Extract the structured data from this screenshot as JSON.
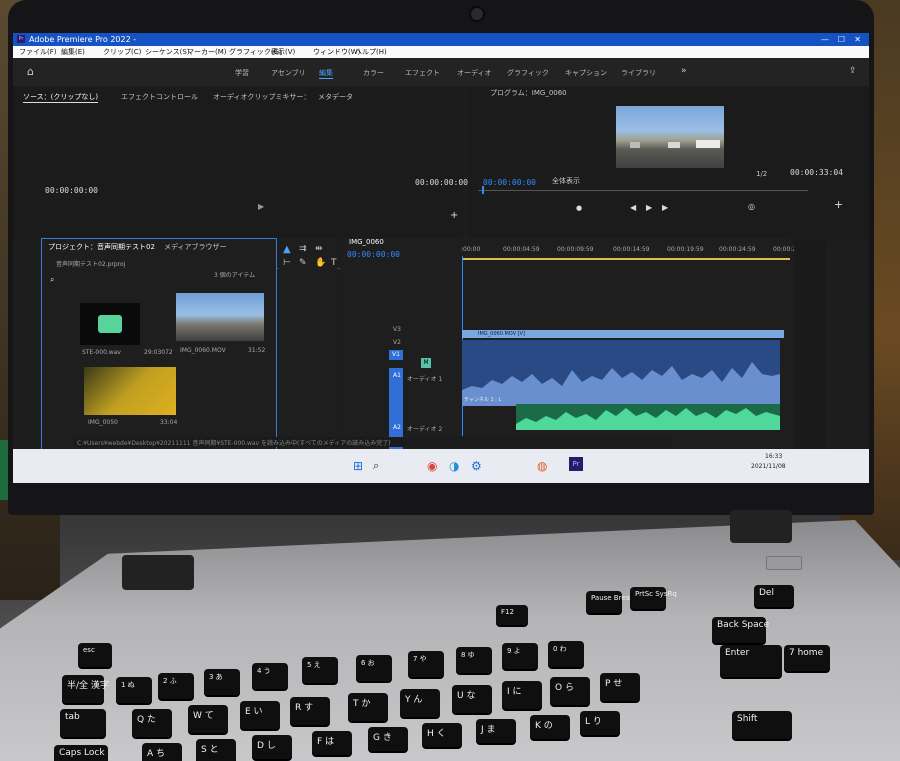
{
  "app": {
    "title": "Adobe Premiere Pro 2022 -",
    "menu": [
      "ファイル(F)",
      "編集(E)",
      "クリップ(C)",
      "シーケンス(S)",
      "マーカー(M)",
      "グラフィック(G)",
      "表示(V)",
      "ウィンドウ(W)",
      "ヘルプ(H)"
    ],
    "workspaces": [
      "学習",
      "アセンブリ",
      "編集",
      "カラー",
      "エフェクト",
      "オーディオ",
      "グラフィック",
      "キャプション",
      "ライブラリ"
    ],
    "active_workspace": "編集",
    "more": "»"
  },
  "source": {
    "tabs": [
      "ソース：(クリップなし)",
      "エフェクトコントロール",
      "オーディオクリップミキサー：",
      "メタデータ"
    ],
    "timecode": "00:00:00:00"
  },
  "program": {
    "title": "プログラム：IMG_0060",
    "timecode_in": "00:00:00:00",
    "timecode_cur": "00:00:00:00",
    "fit": "全体表示",
    "resolution": "1/2",
    "duration": "00:00:33:04"
  },
  "project": {
    "title": "プロジェクト：音声同期テスト02",
    "tab2": "メディアブラウザー",
    "file": "音声同期テスト02.prproj",
    "count": "3 個のアイテム",
    "items": [
      {
        "name": "STE-000.wav",
        "duration": "29:03072"
      },
      {
        "name": "IMG_0060.MOV",
        "duration": "31:52"
      },
      {
        "name": "IMG_0050",
        "duration": "33:04"
      }
    ]
  },
  "timeline": {
    "seq": "IMG_0060",
    "timecode": "00:00:00:00",
    "ruler": [
      ":00:00",
      "00:00:04:59",
      "00:00:09:59",
      "00:00:14:59",
      "00:00:19:59",
      "00:00:24:59",
      "00:00:2"
    ],
    "tracks": [
      "V3",
      "V2",
      "V1",
      "A1",
      "A2"
    ],
    "track_labels": {
      "a1": "オーディオ 1",
      "a2": "オーディオ 2"
    },
    "clip_video": "IMG_0060.MOV [V]",
    "clip_audio": "チャンネル 1 : L"
  },
  "status": {
    "text": "C:¥Users¥webde¥Desktop¥20211111 音声同期¥STE-000.wav を読み込み中(すべてのメディアの読み込み完了)"
  },
  "taskbar": {
    "time": "16:33",
    "date": "2021/11/08"
  },
  "keyboard": {
    "keys": [
      {
        "id": "esc",
        "label": "esc"
      },
      {
        "id": "f12",
        "label": "F12"
      },
      {
        "id": "pause",
        "label": "Pause Break"
      },
      {
        "id": "prtsc",
        "label": "PrtSc SysRq"
      },
      {
        "id": "delete",
        "label": "Del"
      },
      {
        "id": "backspace",
        "label": "Back Space"
      },
      {
        "id": "enter",
        "label": "Enter"
      },
      {
        "id": "tab",
        "label": "tab"
      },
      {
        "id": "capslock",
        "label": "Caps Lock"
      },
      {
        "id": "shift",
        "label": "Shift"
      },
      {
        "id": "home",
        "label": "7 home"
      },
      {
        "id": "k1",
        "label": "1 ぬ"
      },
      {
        "id": "k2",
        "label": "2 ふ"
      },
      {
        "id": "k3",
        "label": "3 あ"
      },
      {
        "id": "k4",
        "label": "4 う"
      },
      {
        "id": "k5",
        "label": "5 え"
      },
      {
        "id": "k6",
        "label": "6 お"
      },
      {
        "id": "k7",
        "label": "7 や"
      },
      {
        "id": "k8",
        "label": "8 ゆ"
      },
      {
        "id": "k9",
        "label": "9 よ"
      },
      {
        "id": "k0",
        "label": "0 わ"
      },
      {
        "id": "q",
        "label": "Q た"
      },
      {
        "id": "w",
        "label": "W て"
      },
      {
        "id": "e",
        "label": "E い"
      },
      {
        "id": "r",
        "label": "R す"
      },
      {
        "id": "t",
        "label": "T か"
      },
      {
        "id": "y",
        "label": "Y ん"
      },
      {
        "id": "u",
        "label": "U な"
      },
      {
        "id": "i",
        "label": "I に"
      },
      {
        "id": "o",
        "label": "O ら"
      },
      {
        "id": "p",
        "label": "P せ"
      },
      {
        "id": "a",
        "label": "A ち"
      },
      {
        "id": "s",
        "label": "S と"
      },
      {
        "id": "d",
        "label": "D し"
      },
      {
        "id": "f",
        "label": "F は"
      },
      {
        "id": "g",
        "label": "G き"
      },
      {
        "id": "h",
        "label": "H く"
      },
      {
        "id": "j",
        "label": "J ま"
      },
      {
        "id": "k",
        "label": "K の"
      },
      {
        "id": "l",
        "label": "L り"
      },
      {
        "id": "hankaku",
        "label": "半/全 漢字"
      }
    ]
  }
}
